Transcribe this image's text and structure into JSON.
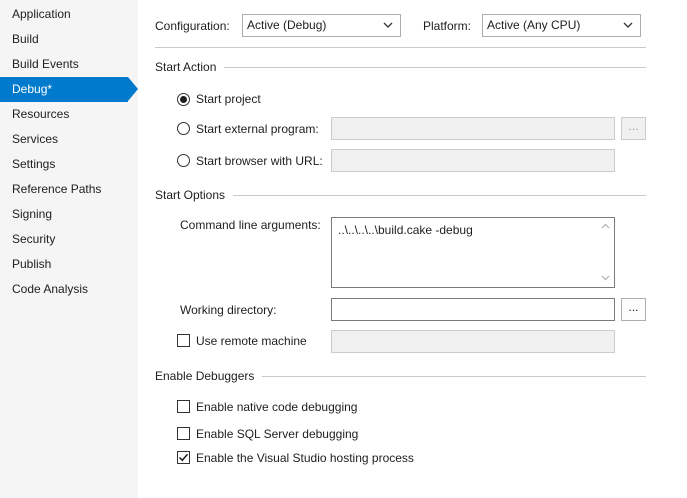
{
  "sidebar": {
    "items": [
      {
        "label": "Application"
      },
      {
        "label": "Build"
      },
      {
        "label": "Build Events"
      },
      {
        "label": "Debug*"
      },
      {
        "label": "Resources"
      },
      {
        "label": "Services"
      },
      {
        "label": "Settings"
      },
      {
        "label": "Reference Paths"
      },
      {
        "label": "Signing"
      },
      {
        "label": "Security"
      },
      {
        "label": "Publish"
      },
      {
        "label": "Code Analysis"
      }
    ],
    "active_index": 3
  },
  "header": {
    "configuration_label": "Configuration:",
    "configuration_value": "Active (Debug)",
    "platform_label": "Platform:",
    "platform_value": "Active (Any CPU)"
  },
  "start_action": {
    "title": "Start Action",
    "start_project": "Start project",
    "start_external": "Start external program:",
    "start_browser": "Start browser with URL:",
    "browse_label": "...",
    "selected": "start_project"
  },
  "start_options": {
    "title": "Start Options",
    "cmd_args_label": "Command line arguments:",
    "cmd_args_value": "..\\..\\..\\..\\build.cake -debug",
    "working_dir_label": "Working directory:",
    "working_dir_value": "",
    "browse_label": "...",
    "remote_label": "Use remote machine",
    "remote_checked": false
  },
  "debuggers": {
    "title": "Enable Debuggers",
    "native_label": "Enable native code debugging",
    "native_checked": false,
    "sql_label": "Enable SQL Server debugging",
    "sql_checked": false,
    "vshost_label": "Enable the Visual Studio hosting process",
    "vshost_checked": true
  },
  "colors": {
    "accent": "#007acc",
    "sidebar_bg": "#f5f5f5",
    "disabled_field": "#f0f0f0"
  }
}
